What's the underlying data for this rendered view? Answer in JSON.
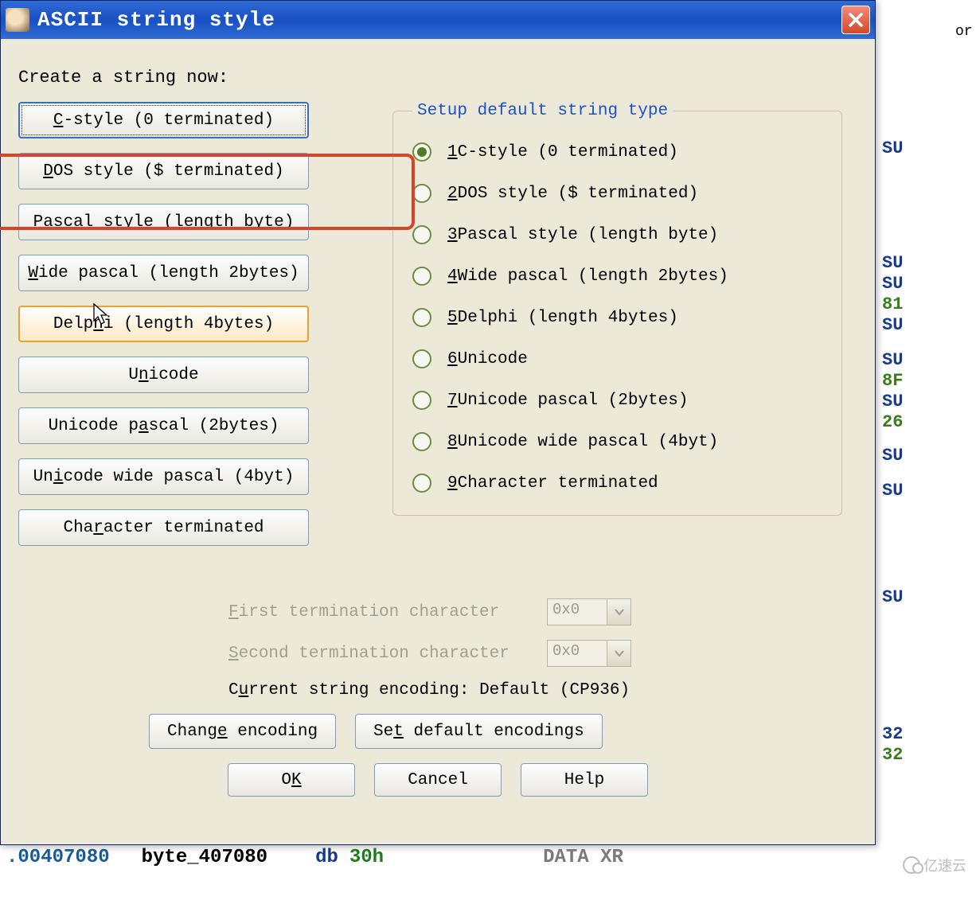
{
  "window": {
    "title": "ASCII string style"
  },
  "prompt": "Create a string now:",
  "buttons": [
    {
      "pre": "",
      "u": "C",
      "post": "-style (0 terminated)",
      "state": "focused"
    },
    {
      "pre": "",
      "u": "D",
      "post": "OS style ($ terminated)",
      "state": ""
    },
    {
      "pre": "",
      "u": "P",
      "post": "ascal style (length byte)",
      "state": ""
    },
    {
      "pre": "",
      "u": "W",
      "post": "ide pascal (length 2bytes)",
      "state": ""
    },
    {
      "pre": "Delp",
      "u": "h",
      "post": "i (length 4bytes)",
      "state": "hovered"
    },
    {
      "pre": "U",
      "u": "n",
      "post": "icode",
      "state": ""
    },
    {
      "pre": "Unicode p",
      "u": "a",
      "post": "scal (2bytes)",
      "state": ""
    },
    {
      "pre": "Un",
      "u": "i",
      "post": "code wide pascal (4byt)",
      "state": ""
    },
    {
      "pre": "Cha",
      "u": "r",
      "post": "acter terminated",
      "state": ""
    }
  ],
  "group_legend": "Setup default string type",
  "radios": [
    {
      "accel": "1",
      "label": " C-style (0 terminated)",
      "checked": true
    },
    {
      "accel": "2",
      "label": " DOS style ($ terminated)",
      "checked": false
    },
    {
      "accel": "3",
      "label": " Pascal style (length byte)",
      "checked": false
    },
    {
      "accel": "4",
      "label": " Wide pascal (length 2bytes)",
      "checked": false
    },
    {
      "accel": "5",
      "label": " Delphi (length 4bytes)",
      "checked": false
    },
    {
      "accel": "6",
      "label": " Unicode",
      "checked": false
    },
    {
      "accel": "7",
      "label": " Unicode pascal (2bytes)",
      "checked": false
    },
    {
      "accel": "8",
      "label": " Unicode wide pascal (4byt)",
      "checked": false
    },
    {
      "accel": "9",
      "label": " Character terminated",
      "checked": false
    }
  ],
  "term1": {
    "pre": "",
    "u": "F",
    "post": "irst termination character",
    "value": "0x0"
  },
  "term2": {
    "pre": "",
    "u": "S",
    "post": "econd termination character",
    "value": "0x0"
  },
  "encoding_line": {
    "pre": "C",
    "u": "u",
    "post": "rrent string encoding:  Default (CP936)"
  },
  "change_enc": {
    "pre": "Chang",
    "u": "e",
    "post": " encoding"
  },
  "set_enc": {
    "pre": "Se",
    "u": "t",
    "post": " default encodings"
  },
  "bottom": {
    "ok": {
      "pre": "O",
      "u": "K",
      "post": ""
    },
    "cancel": "Cancel",
    "help": "Help"
  },
  "bg_text": "or",
  "bg_fragments": [
    "SU",
    "SU",
    "SU",
    "81",
    "SU",
    "SU",
    "8F",
    "SU",
    "26",
    "SU",
    "SU",
    "SU",
    "32"
  ],
  "bot": {
    "a": ".00407080",
    "b": "byte_407080",
    "c": "db",
    "d": "30h",
    "e": "DATA XR"
  },
  "watermark": "亿速云"
}
